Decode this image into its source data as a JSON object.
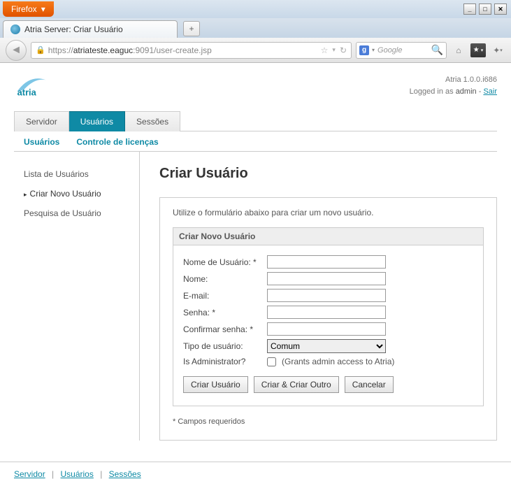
{
  "browser": {
    "name": "Firefox",
    "tab_title": "Atria Server: Criar Usuário",
    "url_prefix": "https://",
    "url_host": "atriateste.eaguc",
    "url_rest": ":9091/user-create.jsp",
    "search_engine": "Google"
  },
  "header": {
    "version": "Atria 1.0.0.i686",
    "logged_in_prefix": "Logged in as ",
    "user": "admin",
    "sep": " - ",
    "logout": "Sair"
  },
  "main_tabs": [
    "Servidor",
    "Usuários",
    "Sessões"
  ],
  "sub_tabs": [
    "Usuários",
    "Controle de licenças"
  ],
  "side_menu": [
    "Lista de Usuários",
    "Criar Novo Usuário",
    "Pesquisa de Usuário"
  ],
  "page": {
    "title": "Criar Usuário",
    "instruction": "Utilize o formulário abaixo para criar um novo usuário.",
    "fieldset_title": "Criar Novo Usuário",
    "labels": {
      "username": "Nome de Usuário: *",
      "name": "Nome:",
      "email": "E-mail:",
      "password": "Senha: *",
      "confirm": "Confirmar senha: *",
      "type": "Tipo de usuário:",
      "is_admin": "Is Administrator?"
    },
    "type_options": [
      "Comum"
    ],
    "type_selected": "Comum",
    "admin_note": "(Grants admin access to Atria)",
    "buttons": {
      "create": "Criar Usuário",
      "create_another": "Criar & Criar Outro",
      "cancel": "Cancelar"
    },
    "required_note": "* Campos requeridos"
  },
  "footer": {
    "servidor": "Servidor",
    "usuarios": "Usuários",
    "sessoes": "Sessões"
  }
}
